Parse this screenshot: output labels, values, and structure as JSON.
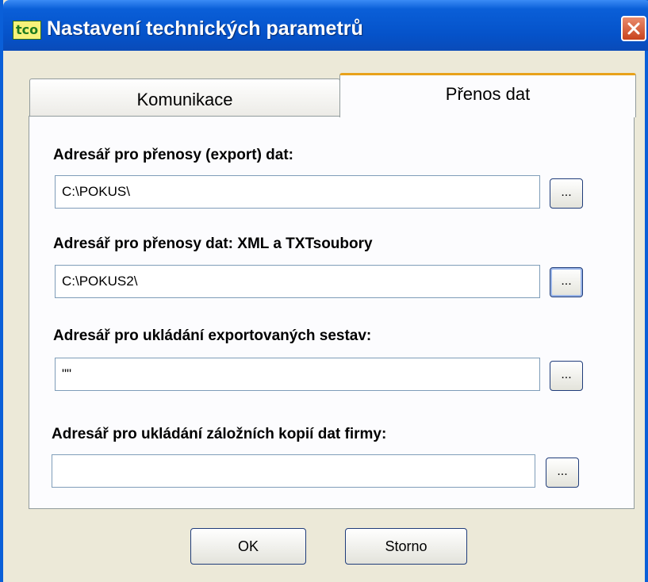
{
  "window": {
    "title": "Nastavení technických parametrů",
    "icon_text": "tco"
  },
  "tabs": [
    {
      "label": "Komunikace",
      "selected": false
    },
    {
      "label": "Přenos dat",
      "selected": true
    }
  ],
  "fields": [
    {
      "label": "Adresář pro přenosy (export) dat:",
      "value": "C:\\POKUS\\",
      "browse_label": "..."
    },
    {
      "label": "Adresář pro přenosy dat: XML a TXTsoubory",
      "value": "C:\\POKUS2\\",
      "browse_label": "..."
    },
    {
      "label": "Adresář pro ukládání exportovaných sestav:",
      "value": "\"\"",
      "browse_label": "..."
    },
    {
      "label": "Adresář pro ukládání záložních kopií dat firmy:",
      "value": "",
      "browse_label": "..."
    }
  ],
  "buttons": {
    "ok": "OK",
    "cancel": "Storno"
  },
  "colors": {
    "titlebar": "#0a5fd8",
    "dialog_bg": "#ece9d8",
    "active_tab_accent": "#e8a21a",
    "close_button": "#c8431d"
  }
}
